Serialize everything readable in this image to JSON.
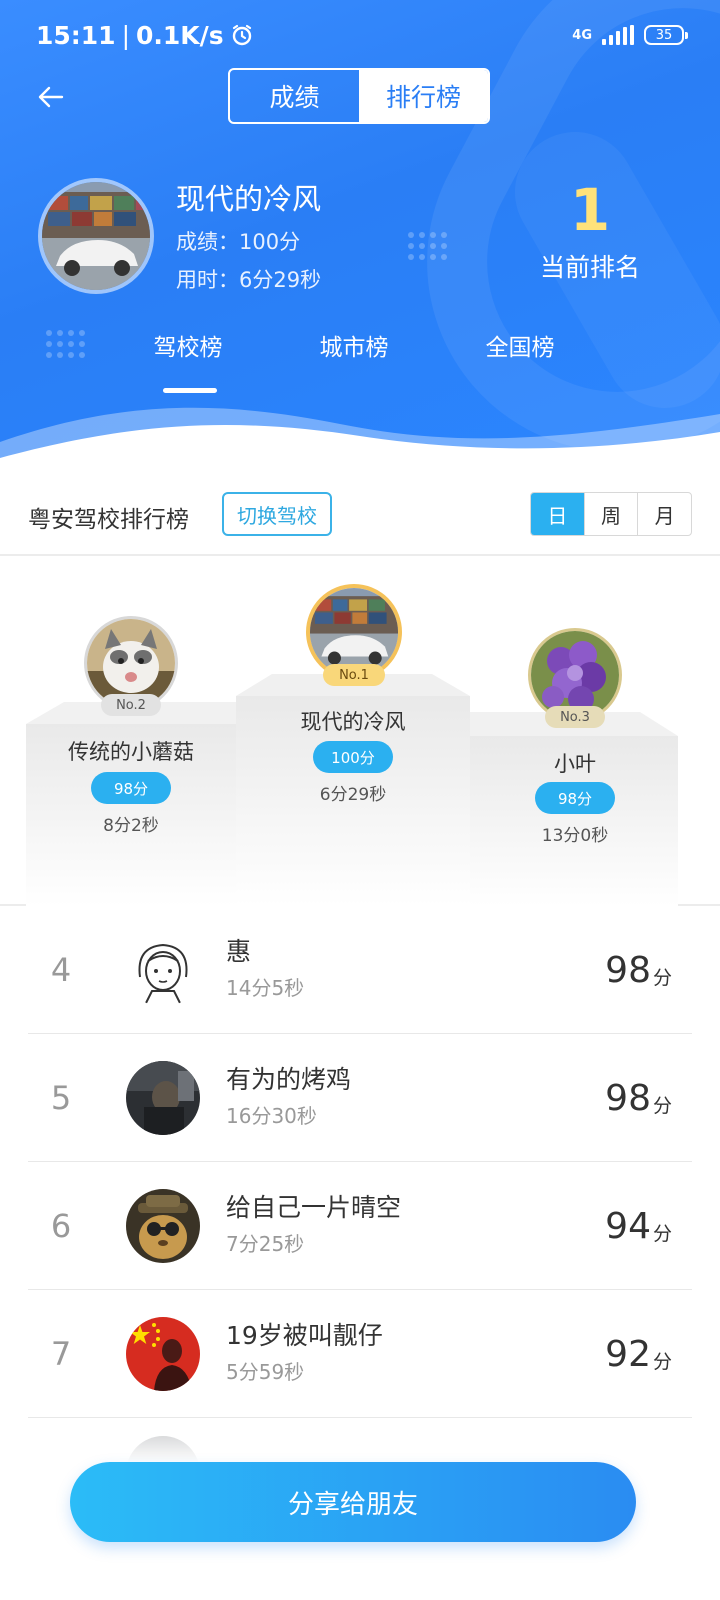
{
  "status_bar": {
    "time": "15:11",
    "separator": "|",
    "speed": "0.1K/s",
    "network": "4G",
    "battery": "35"
  },
  "header": {
    "segments": [
      {
        "label": "成绩",
        "active": false
      },
      {
        "label": "排行榜",
        "active": true
      }
    ],
    "me": {
      "name": "现代的冷风",
      "score_label": "成绩：",
      "score_value": "100分",
      "time_label": "用时：",
      "time_value": "6分29秒"
    },
    "rank": {
      "number": "1",
      "label": "当前排名"
    },
    "tabs": [
      {
        "label": "驾校榜",
        "active": true
      },
      {
        "label": "城市榜",
        "active": false
      },
      {
        "label": "全国榜",
        "active": false
      }
    ]
  },
  "section": {
    "title": "粤安驾校排行榜",
    "switch_label": "切换驾校",
    "periods": [
      {
        "label": "日",
        "active": true
      },
      {
        "label": "周",
        "active": false
      },
      {
        "label": "月",
        "active": false
      }
    ]
  },
  "podium": {
    "first": {
      "badge": "No.1",
      "name": "现代的冷风",
      "score": "100分",
      "time": "6分29秒"
    },
    "second": {
      "badge": "No.2",
      "name": "传统的小蘑菇",
      "score": "98分",
      "time": "8分2秒"
    },
    "third": {
      "badge": "No.3",
      "name": "小叶",
      "score": "98分",
      "time": "13分0秒"
    }
  },
  "list": [
    {
      "rank": "4",
      "name": "惠",
      "time": "14分5秒",
      "score": "98",
      "unit": "分"
    },
    {
      "rank": "5",
      "name": "有为的烤鸡",
      "time": "16分30秒",
      "score": "98",
      "unit": "分"
    },
    {
      "rank": "6",
      "name": "给自己一片晴空",
      "time": "7分25秒",
      "score": "94",
      "unit": "分"
    },
    {
      "rank": "7",
      "name": "19岁被叫靓仔",
      "time": "5分59秒",
      "score": "92",
      "unit": "分"
    }
  ],
  "share_label": "分享给朋友",
  "colors": {
    "header_blue": "#2a7ef5",
    "accent_cyan": "#2bb0f0",
    "rank_gold": "#ffe27a",
    "first_ring": "#f5c25a",
    "third_ring": "#d9c98e"
  }
}
